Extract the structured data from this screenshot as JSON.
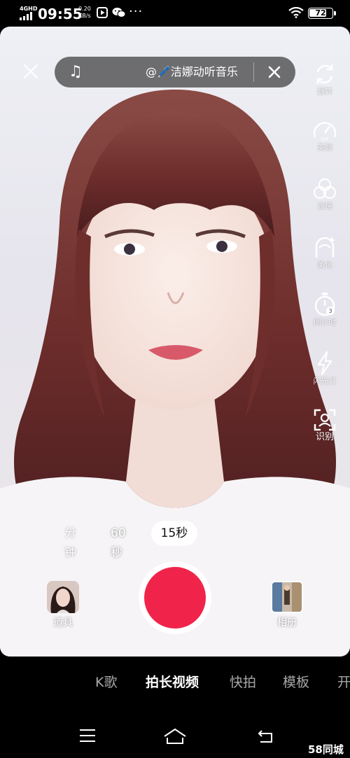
{
  "status_bar": {
    "network": "4GHD",
    "time": "09:55",
    "speed_value": "0.20",
    "speed_unit": "KB/s",
    "dots": "···",
    "battery": "72"
  },
  "music": {
    "title": "@🖊️洁娜动听音乐"
  },
  "side_tools": [
    {
      "label": "翻转",
      "icon": "flip-camera-icon"
    },
    {
      "label": "美颜",
      "icon": "beauty-speedometer-icon"
    },
    {
      "label": "滤镜",
      "icon": "filter-icon"
    },
    {
      "label": "美化",
      "icon": "beautify-face-icon"
    },
    {
      "label": "倒计时",
      "icon": "timer-icon"
    },
    {
      "label": "闪光灯",
      "icon": "flash-icon"
    },
    {
      "label": "识别",
      "icon": "scan-recognize-icon"
    }
  ],
  "durations": {
    "minutes": "分钟",
    "sixty": "60秒",
    "fifteen": "15秒",
    "selected": "15秒"
  },
  "bottom": {
    "props_label": "道具",
    "album_label": "相册"
  },
  "modes": [
    {
      "label": "K歌",
      "active": false
    },
    {
      "label": "拍长视频",
      "active": true
    },
    {
      "label": "快拍",
      "active": false
    },
    {
      "label": "模板",
      "active": false
    },
    {
      "label": "开",
      "active": false
    }
  ],
  "watermark": "58同城",
  "colors": {
    "record": "#f0244a",
    "background": "#000000"
  }
}
